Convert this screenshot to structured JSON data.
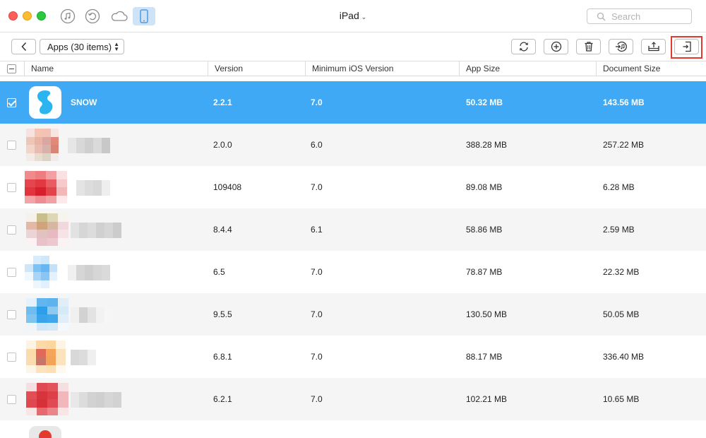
{
  "window": {
    "title": "iPad",
    "search_placeholder": "Search"
  },
  "nav_icons": [
    "music-icon",
    "history-icon",
    "cloud-icon",
    "ipad-device-icon"
  ],
  "toolbar": {
    "category_select": "Apps (30 items)",
    "actions": [
      "refresh-icon",
      "add-icon",
      "delete-icon",
      "to-itunes-icon",
      "export-icon",
      "to-device-icon"
    ]
  },
  "table": {
    "columns": [
      "Name",
      "Version",
      "Minimum iOS Version",
      "App Size",
      "Document Size"
    ],
    "rows": [
      {
        "name": "SNOW",
        "version": "2.2.1",
        "min_ios": "7.0",
        "app_size": "50.32 MB",
        "doc_size": "143.56 MB",
        "selected": true
      },
      {
        "name": "",
        "version": "2.0.0",
        "min_ios": "6.0",
        "app_size": "388.28 MB",
        "doc_size": "257.22 MB",
        "selected": false
      },
      {
        "name": "",
        "version": "109408",
        "min_ios": "7.0",
        "app_size": "89.08 MB",
        "doc_size": "6.28 MB",
        "selected": false
      },
      {
        "name": "",
        "version": "8.4.4",
        "min_ios": "6.1",
        "app_size": "58.86 MB",
        "doc_size": "2.59 MB",
        "selected": false
      },
      {
        "name": "",
        "version": "6.5",
        "min_ios": "7.0",
        "app_size": "78.87 MB",
        "doc_size": "22.32 MB",
        "selected": false
      },
      {
        "name": "",
        "version": "9.5.5",
        "min_ios": "7.0",
        "app_size": "130.50 MB",
        "doc_size": "50.05 MB",
        "selected": false
      },
      {
        "name": "",
        "version": "6.8.1",
        "min_ios": "7.0",
        "app_size": "88.17 MB",
        "doc_size": "336.40 MB",
        "selected": false
      },
      {
        "name": "",
        "version": "6.2.1",
        "min_ios": "7.0",
        "app_size": "102.21 MB",
        "doc_size": "10.65 MB",
        "selected": false
      }
    ]
  },
  "colors": {
    "selection": "#3fa9f5",
    "highlight_box": "#e23a2e",
    "alt_row": "#f5f5f5"
  }
}
